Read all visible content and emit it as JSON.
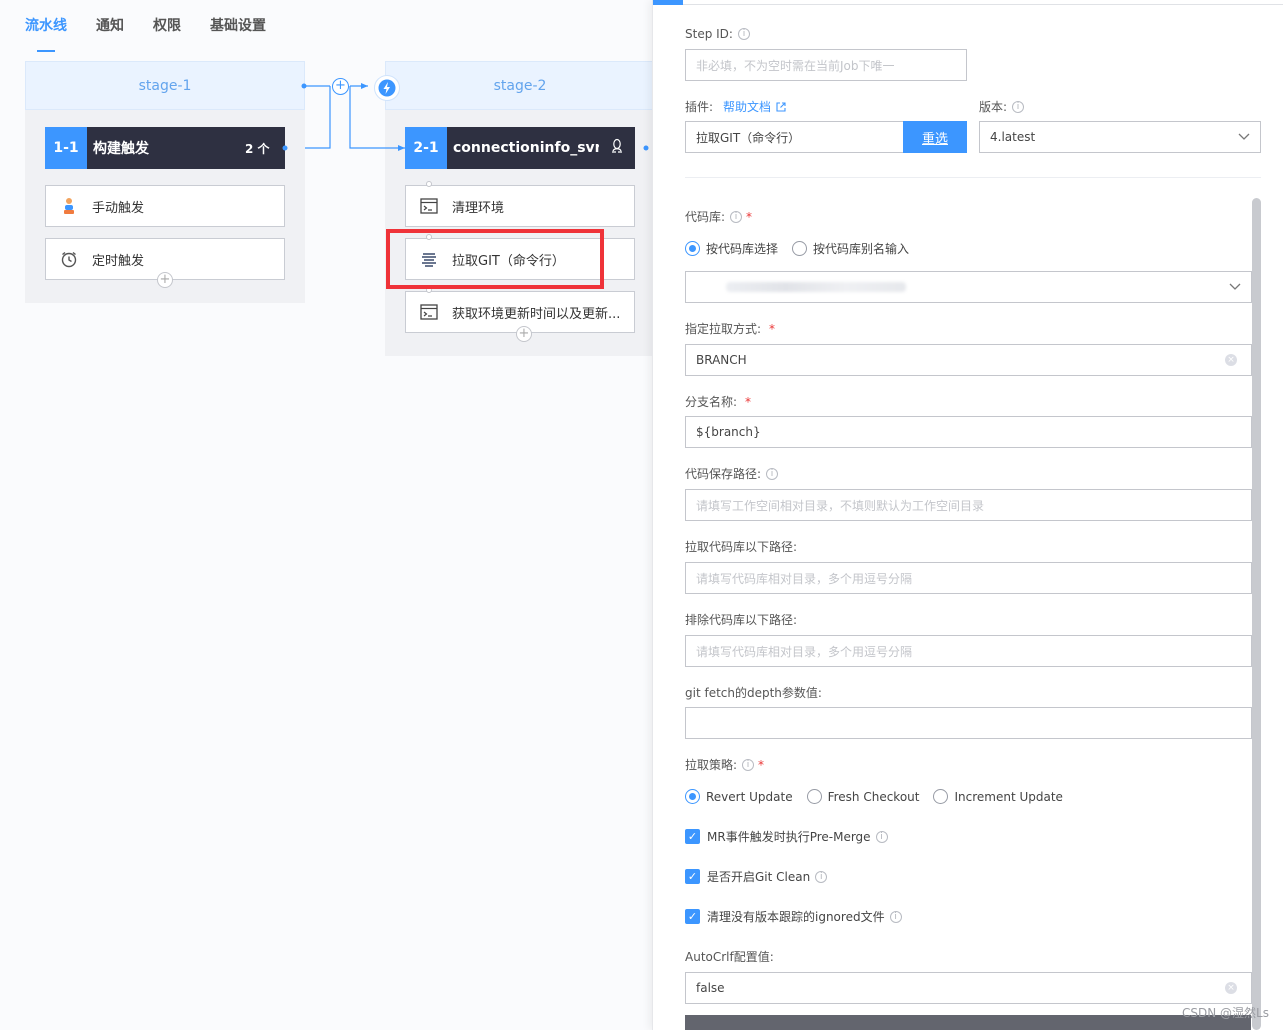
{
  "tabs": [
    "流水线",
    "通知",
    "权限",
    "基础设置"
  ],
  "stage1": {
    "title": "stage-1",
    "job": {
      "num": "1-1",
      "name": "构建触发",
      "count": "2 个"
    },
    "atoms": [
      "手动触发",
      "定时触发"
    ]
  },
  "stage2": {
    "title": "stage-2",
    "job": {
      "num": "2-1",
      "name": "connectioninfo_svr..."
    },
    "atoms": [
      "清理环境",
      "拉取GIT（命令行）",
      "获取环境更新时间以及更新..."
    ]
  },
  "panel": {
    "step_id": {
      "label": "Step ID:",
      "placeholder": "非必填，不为空时需在当前Job下唯一"
    },
    "plugin": {
      "label": "插件:",
      "help": "帮助文档",
      "value": "拉取GIT（命令行）",
      "reselect": "重选"
    },
    "version": {
      "label": "版本:",
      "value": "4.latest"
    },
    "repo": {
      "label": "代码库:",
      "opt1": "按代码库选择",
      "opt2": "按代码库别名输入"
    },
    "pull_type": {
      "label": "指定拉取方式:",
      "value": "BRANCH"
    },
    "branch": {
      "label": "分支名称:",
      "value": "${branch}"
    },
    "save_path": {
      "label": "代码保存路径:",
      "placeholder": "请填写工作空间相对目录，不填则默认为工作空间目录"
    },
    "include_path": {
      "label": "拉取代码库以下路径:",
      "placeholder": "请填写代码库相对目录，多个用逗号分隔"
    },
    "exclude_path": {
      "label": "排除代码库以下路径:",
      "placeholder": "请填写代码库相对目录，多个用逗号分隔"
    },
    "depth": {
      "label": "git fetch的depth参数值:"
    },
    "strategy": {
      "label": "拉取策略:",
      "opt1": "Revert Update",
      "opt2": "Fresh Checkout",
      "opt3": "Increment Update"
    },
    "checks": [
      "MR事件触发时执行Pre-Merge",
      "是否开启Git Clean",
      "清理没有版本跟踪的ignored文件"
    ],
    "autocrlf": {
      "label": "AutoCrlf配置值:",
      "value": "false"
    }
  },
  "watermark": "CSDN @湿然Ls",
  "colors": {
    "accent": "#3c96ff",
    "highlight": "#ef3339",
    "job_bg": "#2e3041"
  }
}
